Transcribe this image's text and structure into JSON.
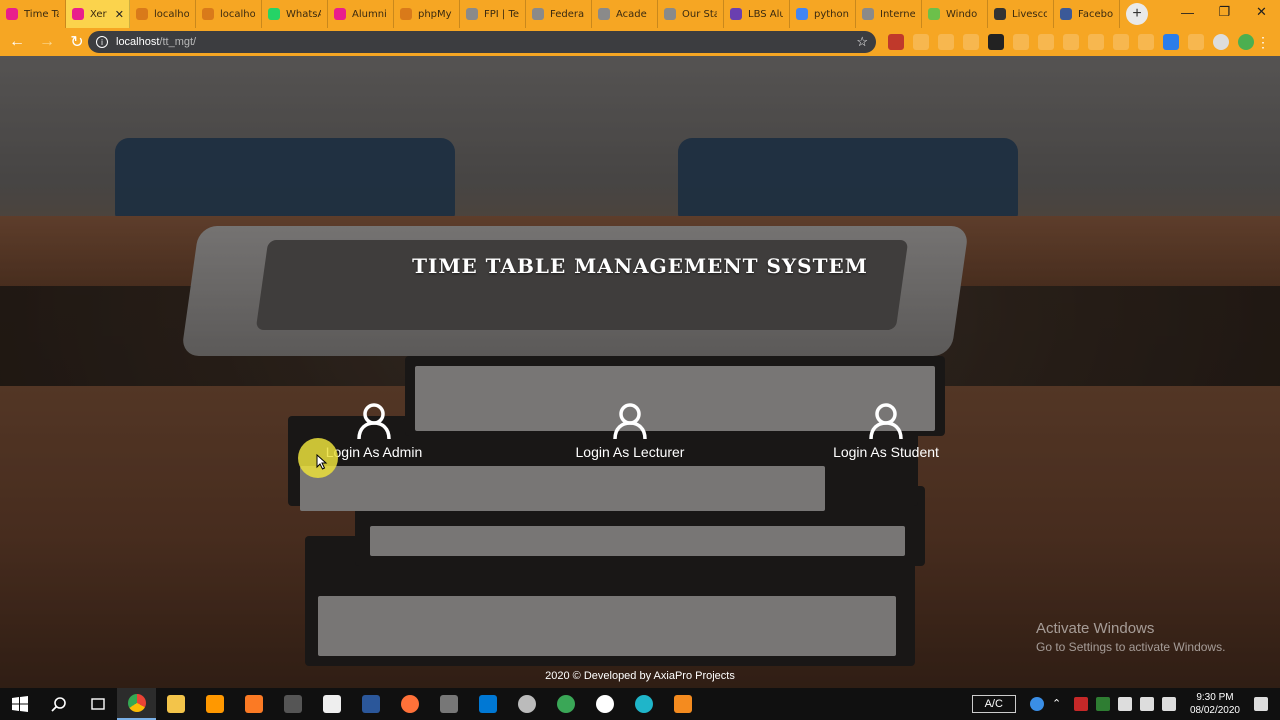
{
  "browser": {
    "tabs": [
      {
        "label": "Time Ta",
        "color": "#e91e8c",
        "active": false
      },
      {
        "label": "Xer",
        "color": "#e91e8c",
        "active": true
      },
      {
        "label": "localho",
        "color": "#d97a1a",
        "active": false
      },
      {
        "label": "localho",
        "color": "#d97a1a",
        "active": false
      },
      {
        "label": "WhatsA",
        "color": "#25d366",
        "active": false
      },
      {
        "label": "Alumni",
        "color": "#e91e8c",
        "active": false
      },
      {
        "label": "phpMy",
        "color": "#d97a1a",
        "active": false
      },
      {
        "label": "FPI | Tet",
        "color": "#8a8a8a",
        "active": false
      },
      {
        "label": "Federal",
        "color": "#8a8a8a",
        "active": false
      },
      {
        "label": "Acade",
        "color": "#8a8a8a",
        "active": false
      },
      {
        "label": "Our Sta",
        "color": "#8a8a8a",
        "active": false
      },
      {
        "label": "LBS Alu",
        "color": "#6a3fb0",
        "active": false
      },
      {
        "label": "python",
        "color": "#4285f4",
        "active": false
      },
      {
        "label": "Interne",
        "color": "#8a8a8a",
        "active": false
      },
      {
        "label": "Windo",
        "color": "#6cc04a",
        "active": false
      },
      {
        "label": "Livesco",
        "color": "#333333",
        "active": false
      },
      {
        "label": "Facebo",
        "color": "#3b5998",
        "active": false
      }
    ],
    "new_tab_glyph": "+",
    "url_host": "localhost",
    "url_path": "/tt_mgt/",
    "accent": "#f6a623"
  },
  "page": {
    "title": "TIME TABLE MANAGEMENT SYSTEM",
    "logins": [
      {
        "label": "Login As Admin"
      },
      {
        "label": "Login As Lecturer"
      },
      {
        "label": "Login As Student"
      }
    ],
    "footer": "2020 © Developed by AxiaPro Projects",
    "watermark_title": "Activate Windows",
    "watermark_sub": "Go to Settings to activate Windows."
  },
  "taskbar": {
    "ac_label": "A/C",
    "time": "9:30 PM",
    "date": "08/02/2020"
  }
}
